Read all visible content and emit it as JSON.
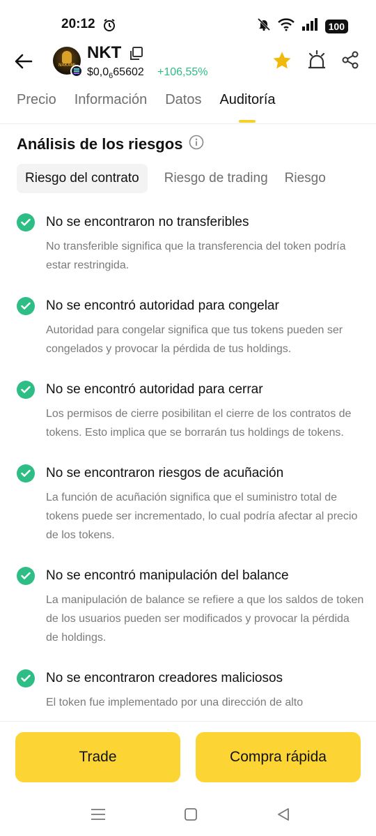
{
  "status_bar": {
    "time": "20:12",
    "battery": "100",
    "icons": [
      "alarm-icon",
      "mute-icon",
      "wifi-icon",
      "signal-icon"
    ]
  },
  "header": {
    "token_symbol": "NKT",
    "avatar_text": "NAKAMI",
    "price_prefix": "$0,0",
    "price_subscript": "6",
    "price_suffix": "65602",
    "change": "+106,55%",
    "colors": {
      "accent": "#FCD535",
      "positive": "#2EBD85"
    }
  },
  "tabs": [
    {
      "label": "Precio"
    },
    {
      "label": "Información"
    },
    {
      "label": "Datos"
    },
    {
      "label": "Auditoría",
      "active": true
    }
  ],
  "section": {
    "title": "Análisis de los riesgos",
    "sub_tabs": [
      {
        "label": "Riesgo del contrato",
        "active": true
      },
      {
        "label": "Riesgo de trading"
      },
      {
        "label": "Riesgo"
      }
    ]
  },
  "risks": [
    {
      "title": "No se encontraron no transferibles",
      "desc": "No transferible significa que la transferencia del token podría estar restringida."
    },
    {
      "title": "No se encontró autoridad para congelar",
      "desc": "Autoridad para congelar significa que tus tokens pueden ser congelados y provocar la pérdida de tus holdings."
    },
    {
      "title": "No se encontró autoridad para cerrar",
      "desc": "Los permisos de cierre posibilitan el cierre de los contratos de tokens. Esto implica que se borrarán tus holdings de tokens."
    },
    {
      "title": "No se encontraron riesgos de acuñación",
      "desc": "La función de acuñación significa que el suministro total de tokens puede ser incrementado, lo cual podría afectar al precio de los tokens."
    },
    {
      "title": "No se encontró manipulación del balance",
      "desc": "La manipulación de balance se refiere a que los saldos de token de los usuarios pueden ser modificados y provocar la pérdida de holdings."
    },
    {
      "title": "No se encontraron creadores maliciosos",
      "desc": "El token fue implementado por una dirección de alto"
    }
  ],
  "bottom": {
    "trade_label": "Trade",
    "quick_buy_label": "Compra rápida"
  }
}
